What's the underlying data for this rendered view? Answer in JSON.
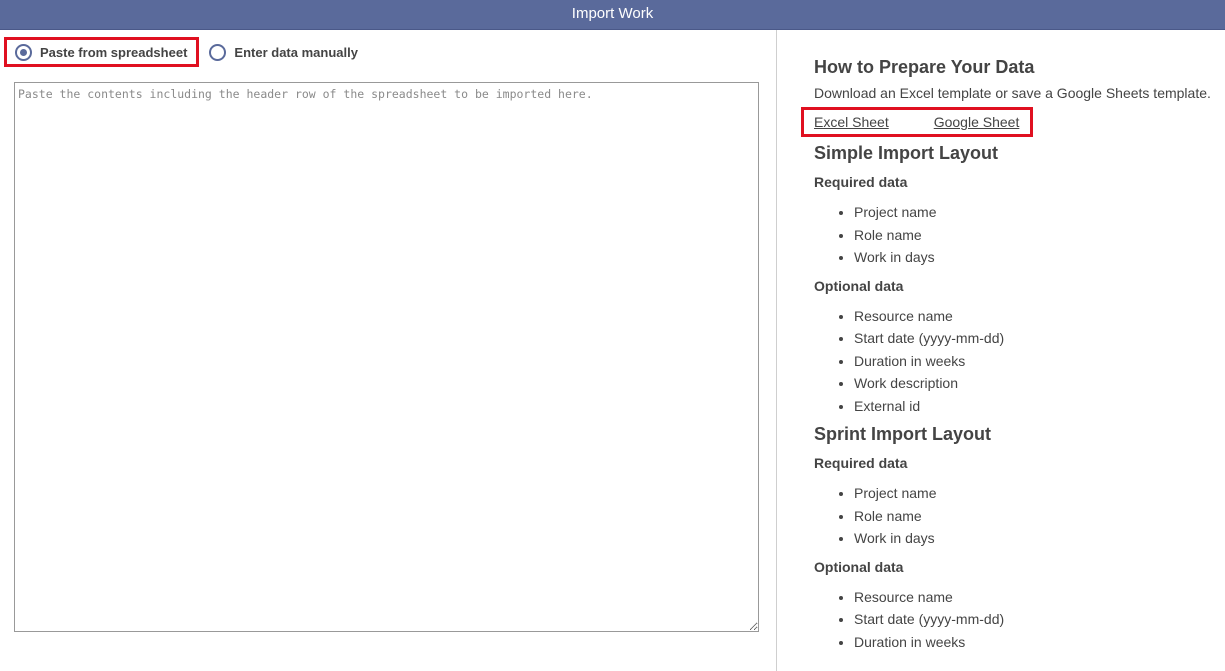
{
  "window": {
    "title": "Import Work"
  },
  "import_mode": {
    "options": [
      {
        "label": "Paste from spreadsheet",
        "selected": true
      },
      {
        "label": "Enter data manually",
        "selected": false
      }
    ]
  },
  "paste_area": {
    "placeholder": "Paste the contents including the header row of the spreadsheet to be imported here.",
    "value": ""
  },
  "help": {
    "title": "How to Prepare Your Data",
    "description": "Download an Excel template or save a Google Sheets template.",
    "links": {
      "excel": "Excel Sheet",
      "google": "Google Sheet"
    },
    "simple_layout": {
      "title": "Simple Import Layout",
      "required_heading": "Required data",
      "required": [
        "Project name",
        "Role name",
        "Work in days"
      ],
      "optional_heading": "Optional data",
      "optional": [
        "Resource name",
        "Start date (yyyy-mm-dd)",
        "Duration in weeks",
        "Work description",
        "External id"
      ]
    },
    "sprint_layout": {
      "title": "Sprint Import Layout",
      "required_heading": "Required data",
      "required": [
        "Project name",
        "Role name",
        "Work in days"
      ],
      "optional_heading": "Optional data",
      "optional": [
        "Resource name",
        "Start date (yyyy-mm-dd)",
        "Duration in weeks"
      ]
    }
  },
  "colors": {
    "header_bg": "#5a6a9b",
    "highlight": "#e01020",
    "text": "#444444"
  }
}
